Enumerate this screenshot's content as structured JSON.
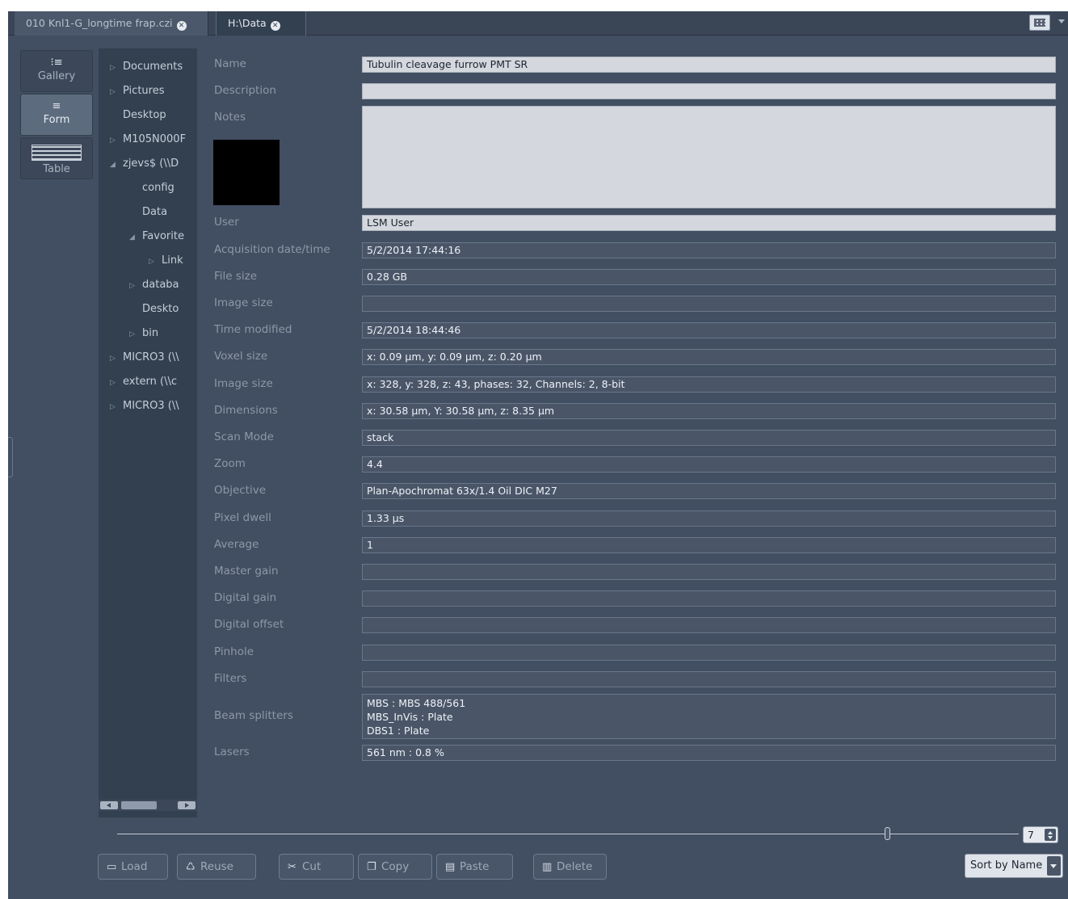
{
  "tabs": [
    {
      "label": "010 Knl1-G_longtime frap.czi",
      "active": false
    },
    {
      "label": "H:\\Data",
      "active": true
    }
  ],
  "view_switch": [
    {
      "label": "Gallery",
      "icon": "gallery-icon"
    },
    {
      "label": "Form",
      "icon": "form-icon",
      "active": true
    },
    {
      "label": "Table",
      "icon": "table-icon"
    }
  ],
  "tree": [
    {
      "label": "Documents",
      "expander": true
    },
    {
      "label": "Pictures",
      "expander": true
    },
    {
      "label": "Desktop",
      "expander": false
    },
    {
      "label": "M105N000F",
      "expander": true
    },
    {
      "label": "zjevs$ (\\\\D",
      "expander": true
    },
    {
      "label": "config",
      "expander": false
    },
    {
      "label": "Data",
      "expander": false
    },
    {
      "label": "Favorite",
      "expander": true
    },
    {
      "label": "Link",
      "expander": true
    },
    {
      "label": "databa",
      "expander": true
    },
    {
      "label": "Deskto",
      "expander": false
    },
    {
      "label": "bin",
      "expander": true
    },
    {
      "label": "MICRO3 (\\\\",
      "expander": true
    },
    {
      "label": "extern (\\\\c",
      "expander": true
    },
    {
      "label": "MICRO3 (\\\\",
      "expander": true
    }
  ],
  "form": {
    "labels": {
      "name": "Name",
      "description": "Description",
      "notes": "Notes",
      "user": "User",
      "acq": "Acquisition date/time",
      "file_size": "File size",
      "image_size": "Image size",
      "time_modified": "Time modified",
      "voxel_size": "Voxel size",
      "image_size2": "Image size",
      "dimensions": "Dimensions",
      "scan_mode": "Scan Mode",
      "zoom": "Zoom",
      "objective": "Objective",
      "pixel_dwell": "Pixel dwell",
      "average": "Average",
      "master_gain": "Master gain",
      "digital_gain": "Digital gain",
      "digital_offset": "Digital offset",
      "pinhole": "Pinhole",
      "filters": "Filters",
      "beam_splitters": "Beam splitters",
      "lasers": "Lasers"
    },
    "values": {
      "name": "Tubulin cleavage furrow PMT SR",
      "description": "",
      "notes": "",
      "user": "LSM User",
      "acq": "5/2/2014 17:44:16",
      "file_size": "0.28 GB",
      "image_size": "",
      "time_modified": "5/2/2014 18:44:46",
      "voxel_size": "x: 0.09 µm, y: 0.09 µm, z: 0.20 µm",
      "image_size2": "x: 328, y: 328, z: 43, phases: 32, Channels: 2, 8-bit",
      "dimensions": "x: 30.58 µm, Y: 30.58 µm, z: 8.35 µm",
      "scan_mode": "stack",
      "zoom": "4.4",
      "objective": "Plan-Apochromat 63x/1.4 Oil DIC M27",
      "pixel_dwell": "1.33 µs",
      "average": "1",
      "master_gain": "",
      "digital_gain": "",
      "digital_offset": "",
      "pinhole": "",
      "filters": "",
      "beam_splitters": [
        "MBS : MBS 488/561",
        "MBS_InVis : Plate",
        "DBS1 : Plate"
      ],
      "lasers": "561 nm : 0.8 %"
    }
  },
  "slider": {
    "value": "7"
  },
  "buttons": {
    "load": "Load",
    "reuse": "Reuse",
    "cut": "Cut",
    "copy": "Copy",
    "paste": "Paste",
    "delete": "Delete",
    "sort": "Sort by Name"
  }
}
